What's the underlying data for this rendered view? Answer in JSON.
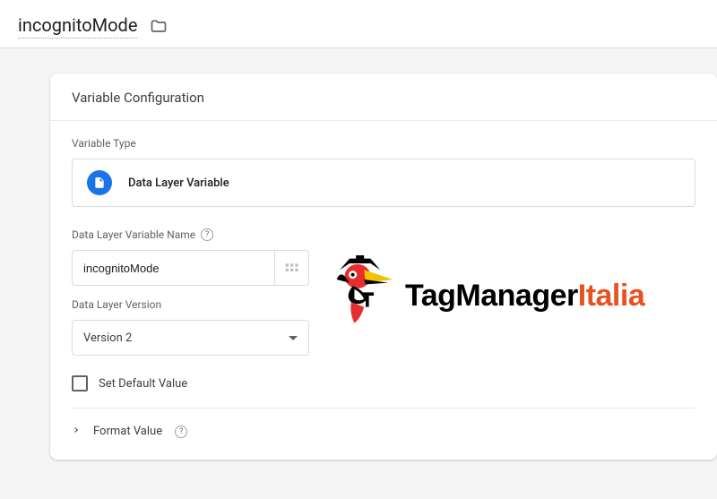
{
  "header": {
    "variable_name": "incognitoMode"
  },
  "card": {
    "title": "Variable Configuration",
    "type_section_label": "Variable Type",
    "type_name": "Data Layer Variable",
    "name_label": "Data Layer Variable Name",
    "name_value": "incognitoMode",
    "version_label": "Data Layer Version",
    "version_value": "Version 2",
    "set_default_label": "Set Default Value",
    "format_label": "Format Value"
  },
  "branding": {
    "prefix": "TagManager",
    "suffix": "Italia"
  }
}
